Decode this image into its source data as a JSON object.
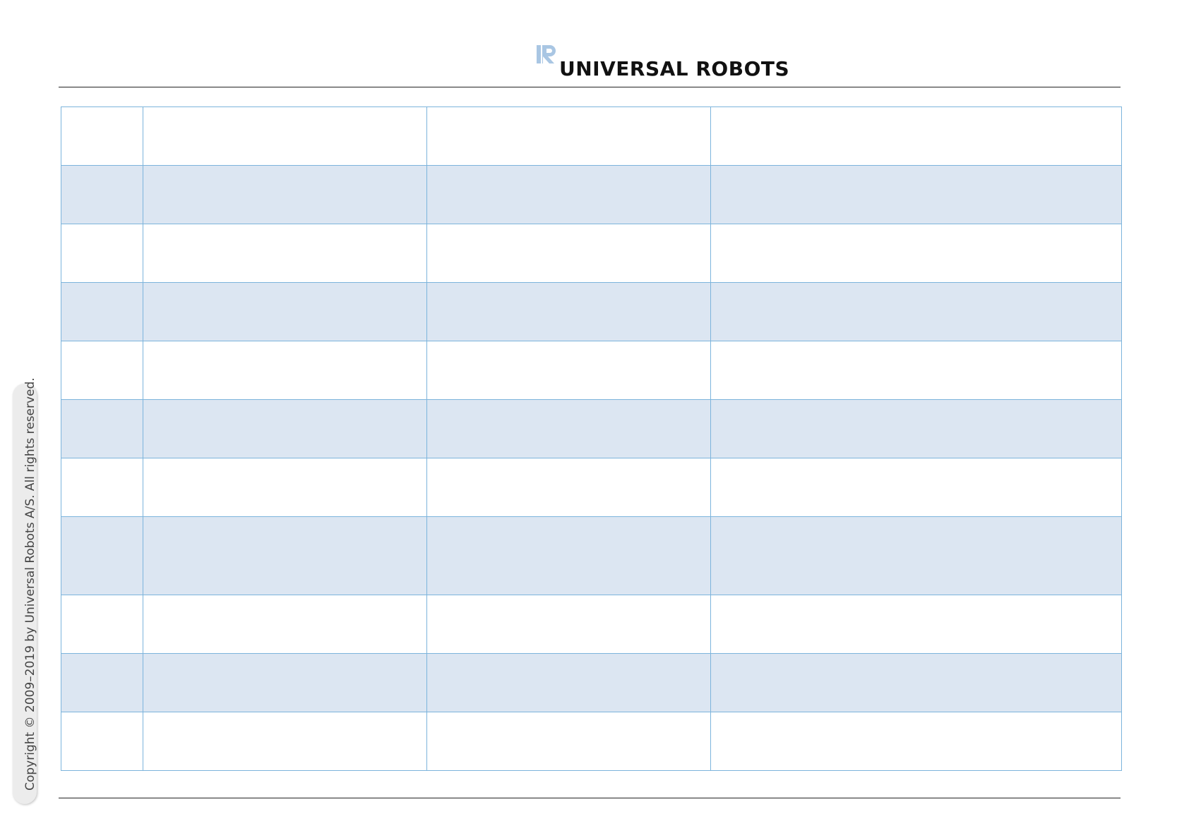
{
  "header": {
    "brand": "UNIVERSAL ROBOTS",
    "logo_icon": "ur-logo-icon",
    "logo_color": "#a9c6e3"
  },
  "table": {
    "rows": [
      {
        "shaded": false,
        "height": "short",
        "cells": [
          "",
          "",
          "",
          ""
        ]
      },
      {
        "shaded": true,
        "height": "short",
        "cells": [
          "",
          "",
          "",
          ""
        ]
      },
      {
        "shaded": false,
        "height": "short",
        "cells": [
          "",
          "",
          "",
          ""
        ]
      },
      {
        "shaded": true,
        "height": "short",
        "cells": [
          "",
          "",
          "",
          ""
        ]
      },
      {
        "shaded": false,
        "height": "short",
        "cells": [
          "",
          "",
          "",
          ""
        ]
      },
      {
        "shaded": true,
        "height": "short",
        "cells": [
          "",
          "",
          "",
          ""
        ]
      },
      {
        "shaded": false,
        "height": "short",
        "cells": [
          "",
          "",
          "",
          ""
        ]
      },
      {
        "shaded": true,
        "height": "tall",
        "cells": [
          "",
          "",
          "",
          ""
        ]
      },
      {
        "shaded": false,
        "height": "short",
        "cells": [
          "",
          "",
          "",
          ""
        ]
      },
      {
        "shaded": true,
        "height": "short",
        "cells": [
          "",
          "",
          "",
          ""
        ]
      },
      {
        "shaded": false,
        "height": "short",
        "cells": [
          "",
          "",
          "",
          ""
        ]
      }
    ],
    "border_color": "#7cb4dc",
    "shade_color": "#dce6f2"
  },
  "sidebar": {
    "copyright": "Copyright © 2009–2019 by Universal Robots A/S. All rights reserved."
  }
}
